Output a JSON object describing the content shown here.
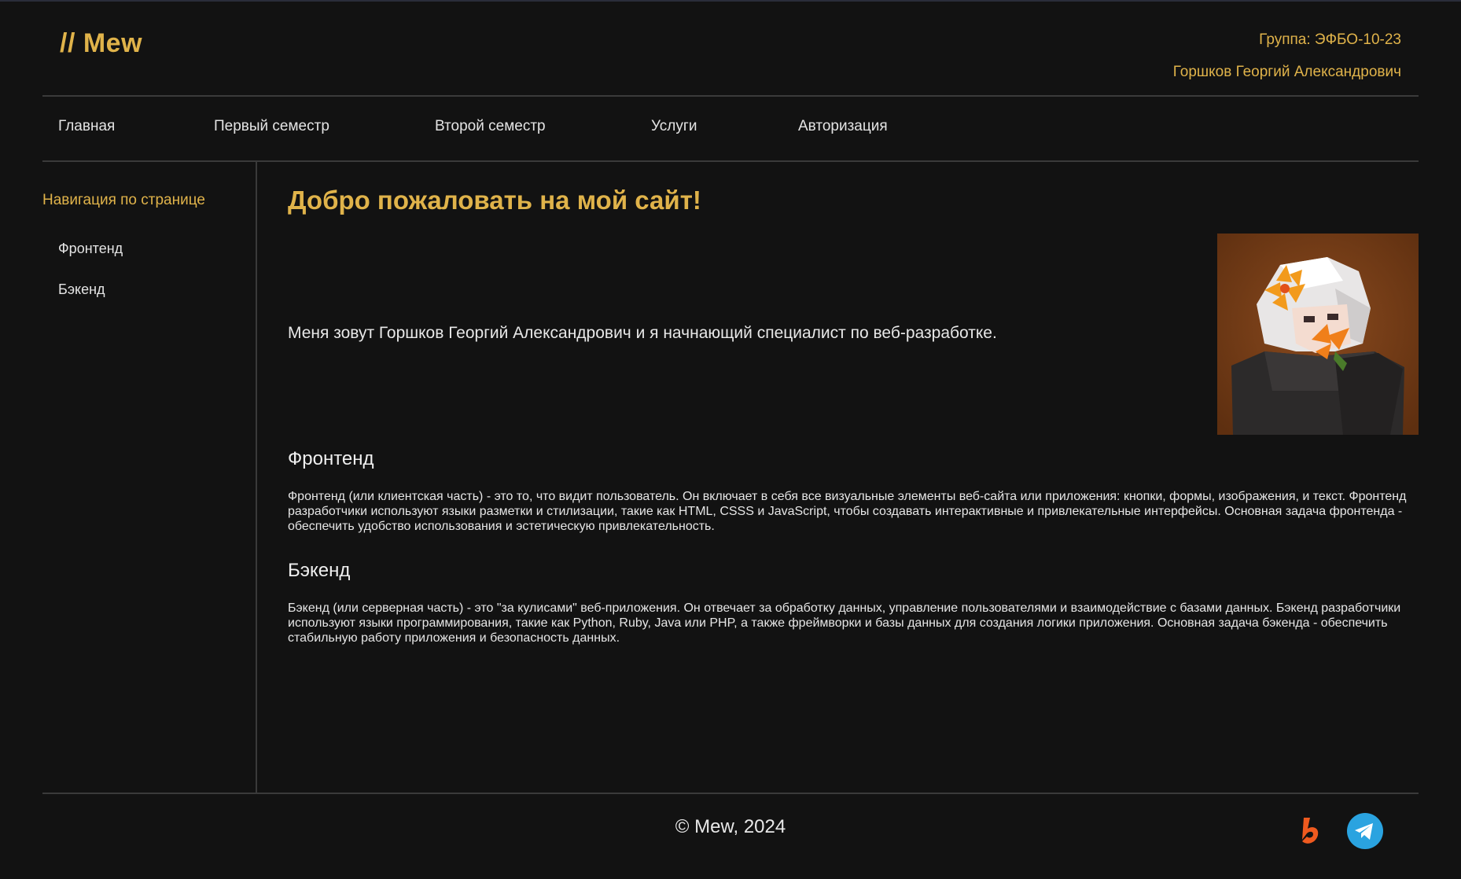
{
  "header": {
    "logo": "// Mew",
    "group": "Группа: ЭФБО-10-23",
    "author": "Горшков Георгий Александрович"
  },
  "nav": {
    "items": [
      {
        "label": "Главная"
      },
      {
        "label": "Первый семестр"
      },
      {
        "label": "Второй семестр"
      },
      {
        "label": "Услуги"
      },
      {
        "label": "Авторизация"
      }
    ]
  },
  "sidebar": {
    "title": "Навигация по странице",
    "links": [
      {
        "label": "Фронтенд"
      },
      {
        "label": "Бэкенд"
      }
    ]
  },
  "main": {
    "title": "Добро пожаловать на мой сайт!",
    "intro": "Меня зовут Горшков Георгий Александрович и я начнающий специалист по веб-разработке.",
    "sections": [
      {
        "heading": "Фронтенд",
        "text": "Фронтенд (или клиентская часть) - это то, что видит пользователь. Он включает в себя все визуальные элементы веб-сайта или приложения: кнопки, формы, изображения, и текст. Фронтенд разработчики используют языки разметки и стилизации, такие как HTML, CSSS и JavaScript, чтобы создавать интерактивные и привлекательные интерфейсы. Основная задача фронтенда - обеспечить удобство использования и эстетическую привлекательность."
      },
      {
        "heading": "Бэкенд",
        "text": "Бэкенд (или серверная часть) - это \"за кулисами\" веб-приложения. Он отвечает за обработку данных, управление пользователями и взаимодействие с базами данных. Бэкенд разработчики используют языки программирования, такие как Python, Ruby, Java или PHP, а также фреймворки и базы данных для создания логики приложения. Основная задача бэкенда - обеспечить стабильную работу приложения и безопасность данных."
      }
    ]
  },
  "footer": {
    "copyright": "© Mew, 2024",
    "icons": [
      "brand-lightning-icon",
      "telegram-icon"
    ]
  },
  "colors": {
    "background": "#121212",
    "accent": "#e0b34a",
    "divider": "#3a3a3a",
    "telegram": "#2aa3e0",
    "brand": "#ef5a1f"
  }
}
